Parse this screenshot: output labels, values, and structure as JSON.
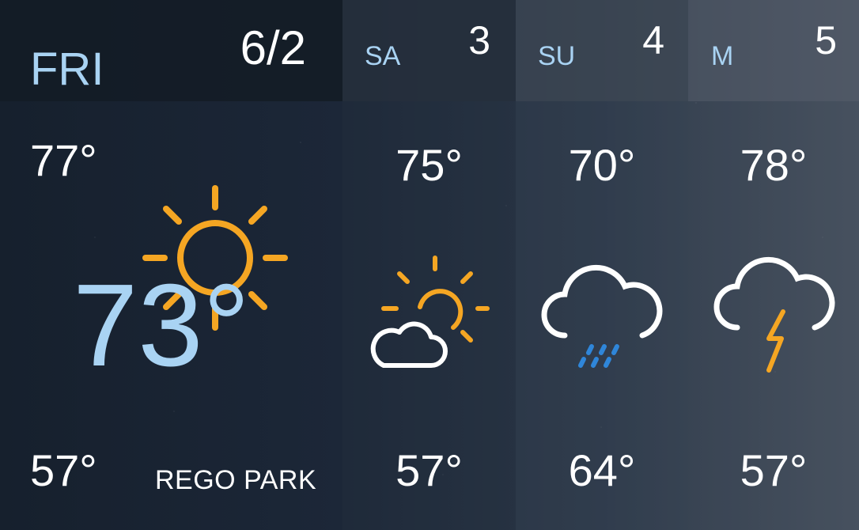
{
  "today": {
    "day": "FRI",
    "date": "6/2",
    "high": "77°",
    "current": "73°",
    "low": "57°",
    "location": "REGO PARK",
    "icon": "sunny-icon"
  },
  "forecast": [
    {
      "day": "SA",
      "date": "3",
      "high": "75°",
      "low": "57°",
      "icon": "partly-cloudy-icon"
    },
    {
      "day": "SU",
      "date": "4",
      "high": "70°",
      "low": "64°",
      "icon": "rain-icon"
    },
    {
      "day": "M",
      "date": "5",
      "high": "78°",
      "low": "57°",
      "icon": "thunderstorm-icon"
    }
  ],
  "colors": {
    "accent_blue": "#a9d3f3",
    "sun_orange": "#f5a623",
    "rain_blue": "#2f86d9",
    "text_white": "#ffffff"
  }
}
